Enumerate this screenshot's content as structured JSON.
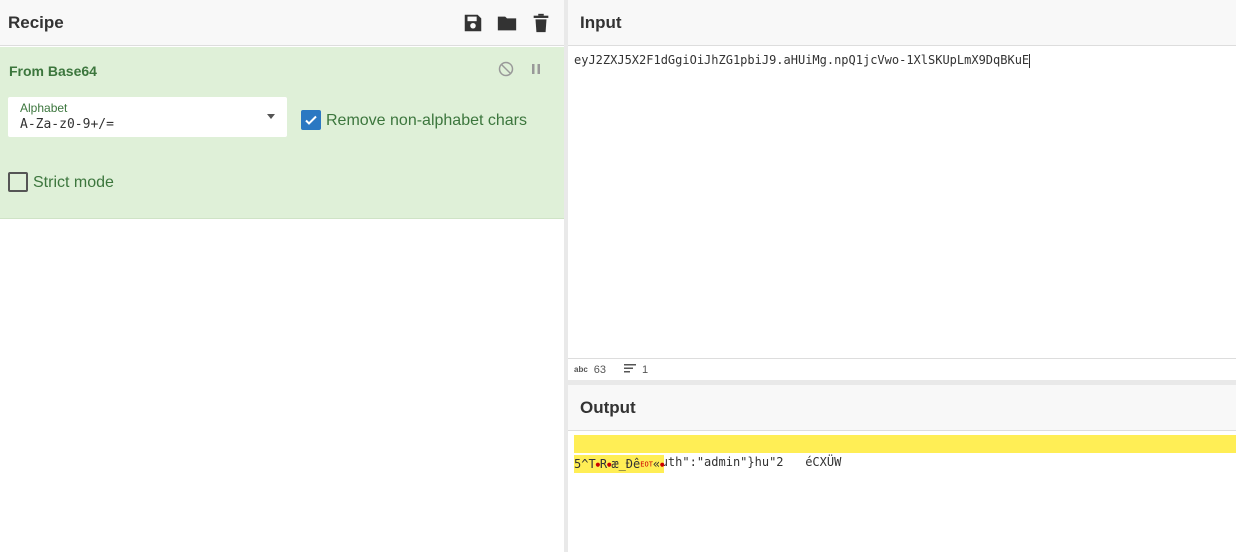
{
  "recipe": {
    "title": "Recipe",
    "icons": [
      "save-icon",
      "folder-icon",
      "trash-icon"
    ],
    "operation": {
      "name": "From Base64",
      "alphabet_label": "Alphabet",
      "alphabet_value": "A-Za-z0-9+/=",
      "remove_non_alpha_label": "Remove non-alphabet chars",
      "remove_non_alpha_checked": true,
      "strict_mode_label": "Strict mode",
      "strict_mode_checked": false
    }
  },
  "input": {
    "title": "Input",
    "text": "eyJ2ZXJ5X2F1dGgiOiJhZG1pbiJ9.aHUiMg.npQ1jcVwo-1XlSKUpLmX9DqBKuE",
    "status": {
      "length_label": "abc",
      "length": "63",
      "lines": "1"
    }
  },
  "output": {
    "title": "Output",
    "line1": "{\"very_auth\":\"admin\"}hu\"2   éCXÜW",
    "line2_a": "5^T",
    "line2_b": "R",
    "line2_c": "æ_Ðê",
    "line2_eot": "EOT",
    "line2_d": "«"
  },
  "colors": {
    "op_bg": "#dff0d8",
    "op_text": "#3c763d",
    "highlight": "#ffee55",
    "checkbox": "#2b78c2"
  }
}
